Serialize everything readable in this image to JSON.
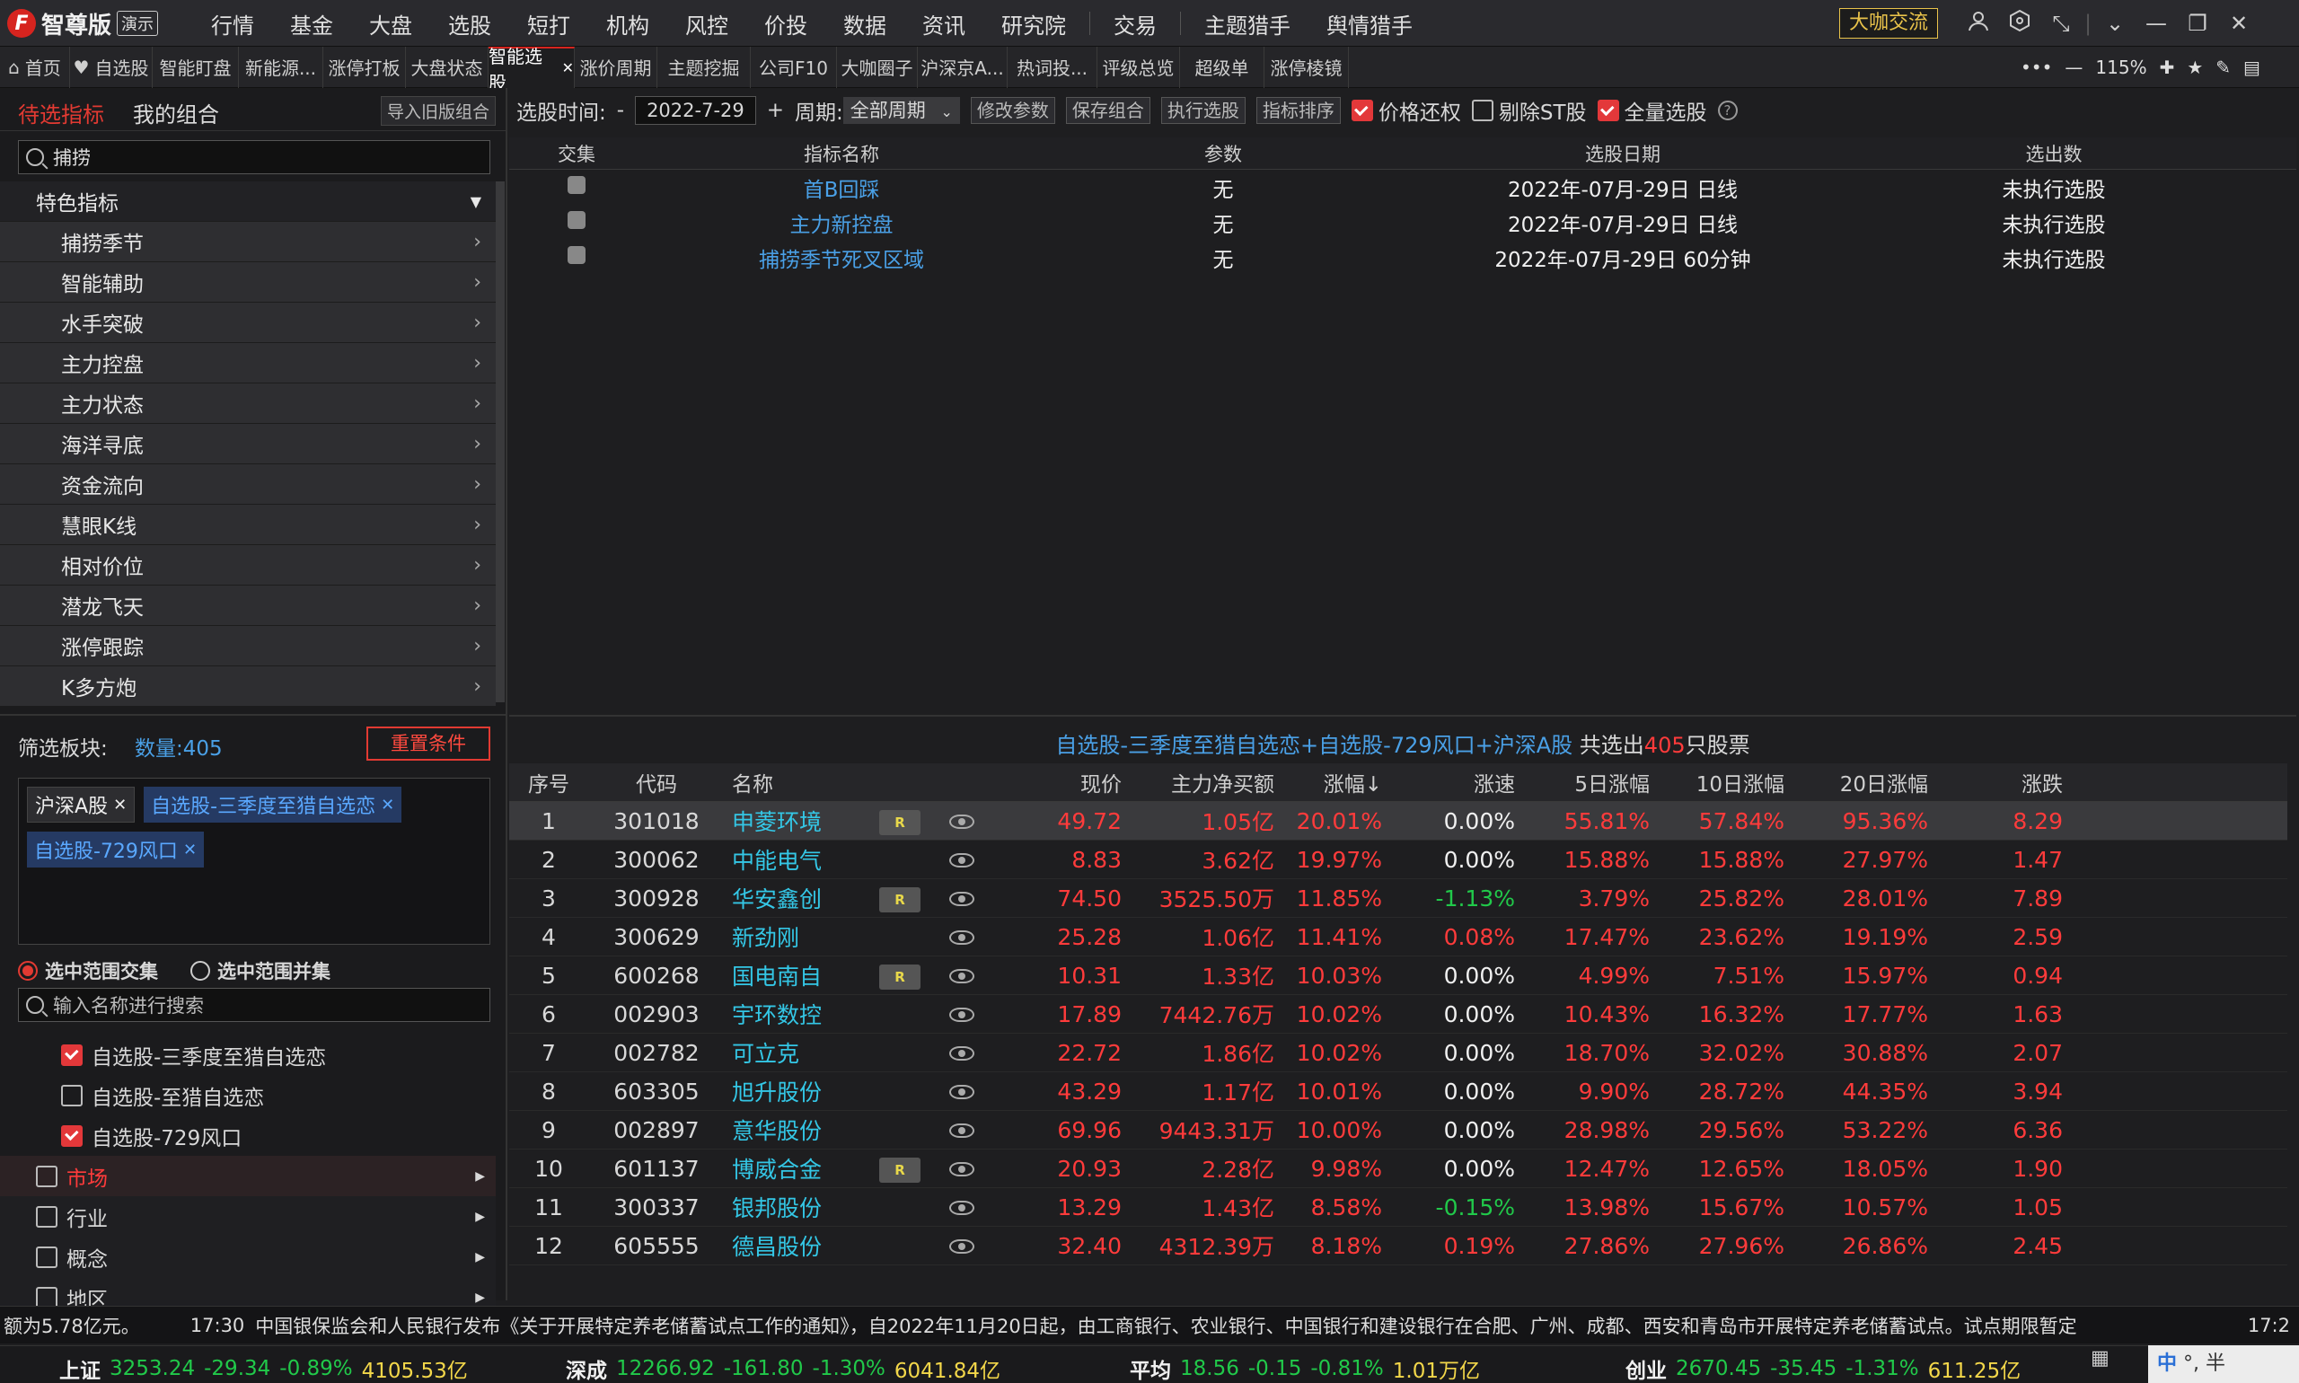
{
  "app": {
    "logo_text": "智尊版",
    "demo_badge": "演示",
    "discuss_button": "大咖交流"
  },
  "main_nav": [
    "行情",
    "基金",
    "大盘",
    "选股",
    "短打",
    "机构",
    "风控",
    "价投",
    "数据",
    "资讯",
    "研究院",
    "交易",
    "主题猎手",
    "舆情猎手"
  ],
  "tabs": [
    {
      "label": "首页",
      "icon": "home-icon"
    },
    {
      "label": "自选股",
      "icon": "heart-icon"
    },
    {
      "label": "智能盯盘"
    },
    {
      "label": "新能源..."
    },
    {
      "label": "涨停打板"
    },
    {
      "label": "大盘状态"
    },
    {
      "label": "智能选股",
      "active": true
    },
    {
      "label": "涨价周期"
    },
    {
      "label": "主题挖掘"
    },
    {
      "label": "公司F10"
    },
    {
      "label": "大咖圈子"
    },
    {
      "label": "沪深京A..."
    },
    {
      "label": "热词投..."
    },
    {
      "label": "评级总览"
    },
    {
      "label": "超级单"
    },
    {
      "label": "涨停棱镜"
    }
  ],
  "zoom": "115%",
  "left_tabs": {
    "indicators": "待选指标",
    "combos": "我的组合",
    "import_button": "导入旧版组合"
  },
  "indicator_search": "捕捞",
  "category_header": "特色指标",
  "categories": [
    "捕捞季节",
    "智能辅助",
    "水手突破",
    "主力控盘",
    "主力状态",
    "海洋寻底",
    "资金流向",
    "慧眼K线",
    "相对价位",
    "潜龙飞天",
    "涨停跟踪",
    "K多方炮"
  ],
  "filter": {
    "label": "筛选板块:",
    "count_label": "数量:405",
    "reset_button": "重置条件",
    "tags": [
      "沪深A股",
      "自选股-三季度至猎自选恋",
      "自选股-729风口"
    ],
    "mode_intersect": "选中范围交集",
    "mode_union": "选中范围并集",
    "search_placeholder": "输入名称进行搜索",
    "options": [
      {
        "label": "自选股-三季度至猎自选恋",
        "checked": true
      },
      {
        "label": "自选股-至猎自选恋",
        "checked": false
      },
      {
        "label": "自选股-729风口",
        "checked": true
      }
    ],
    "groups": [
      {
        "label": "市场",
        "red": true
      },
      {
        "label": "行业"
      },
      {
        "label": "概念"
      },
      {
        "label": "地区"
      }
    ]
  },
  "toolbar": {
    "time_label": "选股时间:",
    "minus": "-",
    "date": "2022-7-29",
    "plus": "+",
    "period_label": "周期:",
    "period_value": "全部周期",
    "edit_params": "修改参数",
    "save_combo": "保存组合",
    "run": "执行选股",
    "sort": "指标排序",
    "price_restore": "价格还权",
    "exclude_st": "剔除ST股",
    "all_stocks": "全量选股"
  },
  "indicator_table": {
    "headers": [
      "交集",
      "指标名称",
      "参数",
      "选股日期",
      "选出数"
    ],
    "rows": [
      [
        "首B回踩",
        "无",
        "2022年-07月-29日 日线",
        "未执行选股"
      ],
      [
        "主力新控盘",
        "无",
        "2022年-07月-29日 日线",
        "未执行选股"
      ],
      [
        "捕捞季节死叉区域",
        "无",
        "2022年-07月-29日 60分钟",
        "未执行选股"
      ]
    ]
  },
  "result_title": {
    "prefix": "自选股-三季度至猎自选恋+自选股-729风口+沪深A股",
    "mid": " 共选出",
    "count": "405",
    "suffix": "只股票"
  },
  "stock_table": {
    "headers": [
      "序号",
      "代码",
      "名称",
      "",
      "",
      "现价",
      "主力净买额",
      "涨幅↓",
      "涨速",
      "5日涨幅",
      "10日涨幅",
      "20日涨幅",
      "涨跌"
    ],
    "rows": [
      [
        "1",
        "301018",
        "申菱环境",
        "R",
        "49.72",
        "1.05亿",
        "20.01%",
        "0.00%",
        "55.81%",
        "57.84%",
        "95.36%",
        "8.29"
      ],
      [
        "2",
        "300062",
        "中能电气",
        "",
        "8.83",
        "3.62亿",
        "19.97%",
        "0.00%",
        "15.88%",
        "15.88%",
        "27.97%",
        "1.47"
      ],
      [
        "3",
        "300928",
        "华安鑫创",
        "R",
        "74.50",
        "3525.50万",
        "11.85%",
        "-1.13%",
        "3.79%",
        "25.82%",
        "28.01%",
        "7.89"
      ],
      [
        "4",
        "300629",
        "新劲刚",
        "",
        "25.28",
        "1.06亿",
        "11.41%",
        "0.08%",
        "17.47%",
        "23.62%",
        "19.19%",
        "2.59"
      ],
      [
        "5",
        "600268",
        "国电南自",
        "R",
        "10.31",
        "1.33亿",
        "10.03%",
        "0.00%",
        "4.99%",
        "7.51%",
        "15.97%",
        "0.94"
      ],
      [
        "6",
        "002903",
        "宇环数控",
        "",
        "17.89",
        "7442.76万",
        "10.02%",
        "0.00%",
        "10.43%",
        "16.32%",
        "17.77%",
        "1.63"
      ],
      [
        "7",
        "002782",
        "可立克",
        "",
        "22.72",
        "1.86亿",
        "10.02%",
        "0.00%",
        "18.70%",
        "32.02%",
        "30.88%",
        "2.07"
      ],
      [
        "8",
        "603305",
        "旭升股份",
        "",
        "43.29",
        "1.17亿",
        "10.01%",
        "0.00%",
        "9.90%",
        "28.72%",
        "44.35%",
        "3.94"
      ],
      [
        "9",
        "002897",
        "意华股份",
        "",
        "69.96",
        "9443.31万",
        "10.00%",
        "0.00%",
        "28.98%",
        "29.56%",
        "53.22%",
        "6.36"
      ],
      [
        "10",
        "601137",
        "博威合金",
        "R",
        "20.93",
        "2.28亿",
        "9.98%",
        "0.00%",
        "12.47%",
        "12.65%",
        "18.05%",
        "1.90"
      ],
      [
        "11",
        "300337",
        "银邦股份",
        "",
        "13.29",
        "1.43亿",
        "8.58%",
        "-0.15%",
        "13.98%",
        "15.67%",
        "10.57%",
        "1.05"
      ],
      [
        "12",
        "605555",
        "德昌股份",
        "",
        "32.40",
        "4312.39万",
        "8.18%",
        "0.19%",
        "27.86%",
        "27.96%",
        "26.86%",
        "2.45"
      ]
    ]
  },
  "ticker": {
    "left": "额为5.78亿元。",
    "time": "17:30",
    "text": "中国银保监会和人民银行发布《关于开展特定养老储蓄试点工作的通知》，自2022年11月20日起，由工商银行、农业银行、中国银行和建设银行在合肥、广州、成都、西安和青岛市开展特定养老储蓄试点。试点期限暂定",
    "clock": "17:2"
  },
  "indices": [
    {
      "name": "上证",
      "value": "3253.24",
      "chg": "-29.34",
      "pct": "-0.89%",
      "amt": "4105.53亿"
    },
    {
      "name": "深成",
      "value": "12266.92",
      "chg": "-161.80",
      "pct": "-1.30%",
      "amt": "6041.84亿"
    },
    {
      "name": "平均",
      "value": "18.56",
      "chg": "-0.15",
      "pct": "-0.81%",
      "amt": "1.01万亿"
    },
    {
      "name": "创业",
      "value": "2670.45",
      "chg": "-35.45",
      "pct": "-1.31%",
      "amt": "611.25亿"
    }
  ],
  "ime": "中 °, 半"
}
